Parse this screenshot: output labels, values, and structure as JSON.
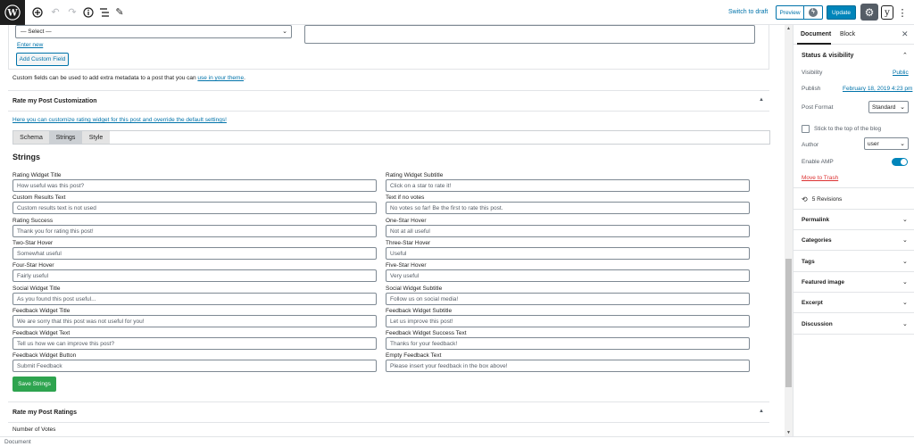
{
  "toolbar": {
    "add_icon": "plus-circle-icon",
    "undo_icon": "undo-icon",
    "redo_icon": "redo-icon",
    "info_icon": "info-icon",
    "outline_icon": "list-icon",
    "tools_icon": "pencil-icon",
    "switch_to_draft": "Switch to draft",
    "preview": "Preview",
    "update": "Update"
  },
  "custom_fields": {
    "select_value": "— Select —",
    "enter_new": "Enter new",
    "add_button": "Add Custom Field",
    "help_text": "Custom fields can be used to add extra metadata to a post that you can ",
    "help_link": "use in your theme",
    "help_end": "."
  },
  "rmp_customization": {
    "title": "Rate my Post Customization",
    "intro_link": "Here you can customize rating widget for this post and override the default settings!",
    "tabs": [
      {
        "label": "Schema",
        "active": false
      },
      {
        "label": "Strings",
        "active": true
      },
      {
        "label": "Style",
        "active": false
      }
    ],
    "section_title": "Strings",
    "fields": [
      {
        "label": "Rating Widget Title",
        "placeholder": "How useful was this post?"
      },
      {
        "label": "Rating Widget Subtitle",
        "placeholder": "Click on a star to rate it!"
      },
      {
        "label": "Custom Results Text",
        "placeholder": "Custom results text is not used"
      },
      {
        "label": "Text if no votes",
        "placeholder": "No votes so far! Be the first to rate this post."
      },
      {
        "label": "Rating Success",
        "placeholder": "Thank you for rating this post!"
      },
      {
        "label": "One-Star Hover",
        "placeholder": "Not at all useful"
      },
      {
        "label": "Two-Star Hover",
        "placeholder": "Somewhat useful"
      },
      {
        "label": "Three-Star Hover",
        "placeholder": "Useful"
      },
      {
        "label": "Four-Star Hover",
        "placeholder": "Fairly useful"
      },
      {
        "label": "Five-Star Hover",
        "placeholder": "Very useful"
      },
      {
        "label": "Social Widget Title",
        "placeholder": "As you found this post useful..."
      },
      {
        "label": "Social Widget Subtitle",
        "placeholder": "Follow us on social media!"
      },
      {
        "label": "Feedback Widget Title",
        "placeholder": "We are sorry that this post was not useful for you!"
      },
      {
        "label": "Feedback Widget Subtitle",
        "placeholder": "Let us improve this post!"
      },
      {
        "label": "Feedback Widget Text",
        "placeholder": "Tell us how we can improve this post?"
      },
      {
        "label": "Feedback Widget Success Text",
        "placeholder": "Thanks for your feedback!"
      },
      {
        "label": "Feedback Widget Button",
        "placeholder": "Submit Feedback"
      },
      {
        "label": "Empty Feedback Text",
        "placeholder": "Please insert your feedback in the box above!"
      }
    ],
    "save_button": "Save Strings"
  },
  "rmp_ratings": {
    "title": "Rate my Post Ratings",
    "number_of_votes_label": "Number of Votes"
  },
  "statusbar": {
    "breadcrumb": "Document"
  },
  "sidebar": {
    "tab_document": "Document",
    "tab_block": "Block",
    "status_title": "Status & visibility",
    "visibility_label": "Visibility",
    "visibility_value": "Public",
    "publish_label": "Publish",
    "publish_value": "February 18, 2019 4:23 pm",
    "post_format_label": "Post Format",
    "post_format_value": "Standard",
    "stick_label": "Stick to the top of the blog",
    "author_label": "Author",
    "author_value": "user",
    "amp_label": "Enable AMP",
    "amp_enabled": true,
    "trash_link": "Move to Trash",
    "revisions": "5 Revisions",
    "panels": [
      "Permalink",
      "Categories",
      "Tags",
      "Featured image",
      "Excerpt",
      "Discussion"
    ]
  }
}
